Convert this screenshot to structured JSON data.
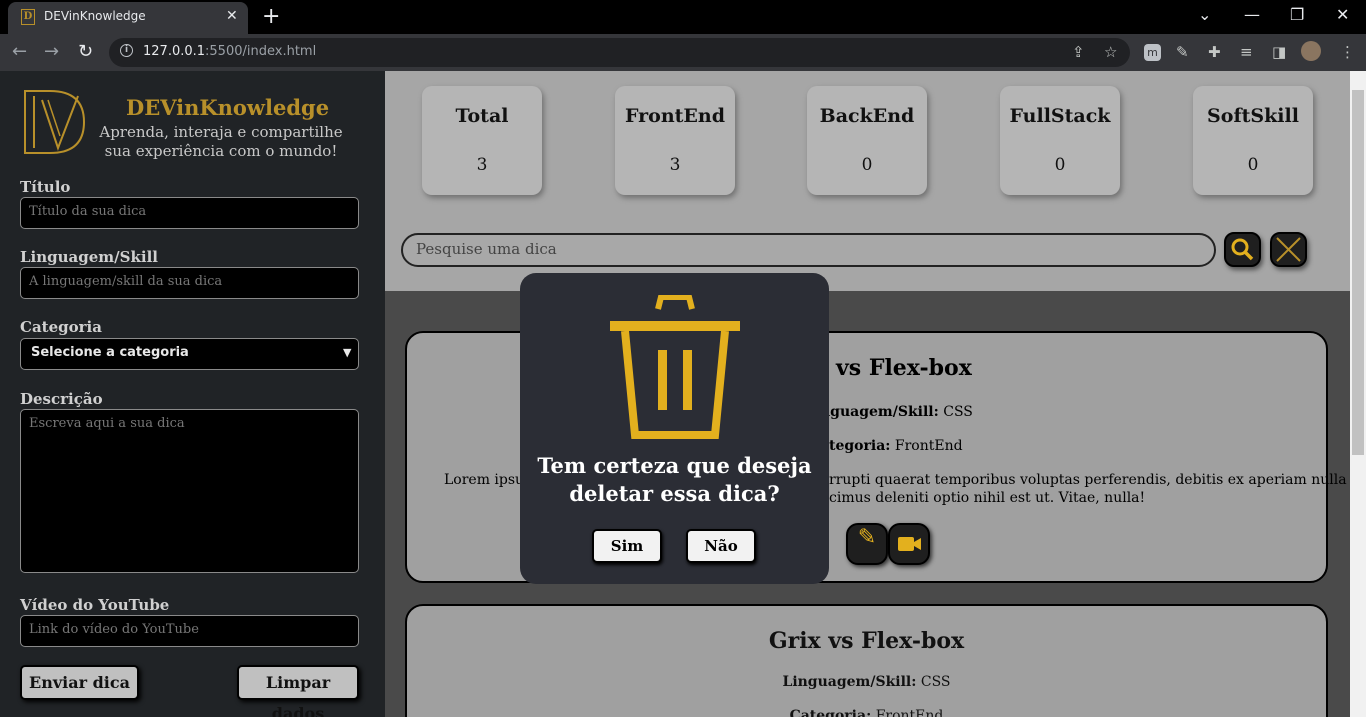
{
  "browser": {
    "tab_title": "DEVinKnowledge",
    "tab_close": "✕",
    "new_tab": "+",
    "url_host": "127.0.0.1",
    "url_path": ":5500/index.html"
  },
  "app": {
    "title": "DEVinKnowledge",
    "subtitle": "Aprenda, interaja e compartilhe sua experiência com o mundo!"
  },
  "form": {
    "title_label": "Título",
    "title_placeholder": "Título da sua dica",
    "lang_label": "Linguagem/Skill",
    "lang_placeholder": "A linguagem/skill da sua dica",
    "category_label": "Categoria",
    "category_selected": "Selecione a categoria",
    "desc_label": "Descrição",
    "desc_placeholder": "Escreva aqui a sua dica",
    "video_label": "Vídeo do YouTube",
    "video_placeholder": "Link do vídeo do YouTube",
    "submit_label": "Enviar dica",
    "clear_label": "Limpar dados"
  },
  "stats": [
    {
      "label": "Total",
      "value": "3"
    },
    {
      "label": "FrontEnd",
      "value": "3"
    },
    {
      "label": "BackEnd",
      "value": "0"
    },
    {
      "label": "FullStack",
      "value": "0"
    },
    {
      "label": "SoftSkill",
      "value": "0"
    }
  ],
  "search": {
    "placeholder": "Pesquise uma dica"
  },
  "tips": [
    {
      "title_visible": "vs Flex-box",
      "lang_label_visible": "nguagem/Skill:",
      "lang": "CSS",
      "cat_label_visible": "tegoria:",
      "category": "FrontEnd",
      "desc_left": "Lorem ipsu",
      "desc_right_1": "rrupti quaerat temporibus voluptas perferendis, debitis ex aperiam nulla",
      "desc_right_2": "cimus deleniti optio nihil est ut. Vitae, nulla!"
    },
    {
      "title": "Grix vs Flex-box",
      "lang_label": "Linguagem/Skill:",
      "lang": "CSS",
      "cat_label": "Categoria:",
      "category": "FrontEnd"
    }
  ],
  "modal": {
    "question": "Tem certeza que deseja deletar essa dica?",
    "yes_label": "Sim",
    "no_label": "Não"
  },
  "colors": {
    "accent": "#b8902a",
    "icon_yellow": "#e3b01e",
    "modal_bg": "#2b2d35"
  }
}
